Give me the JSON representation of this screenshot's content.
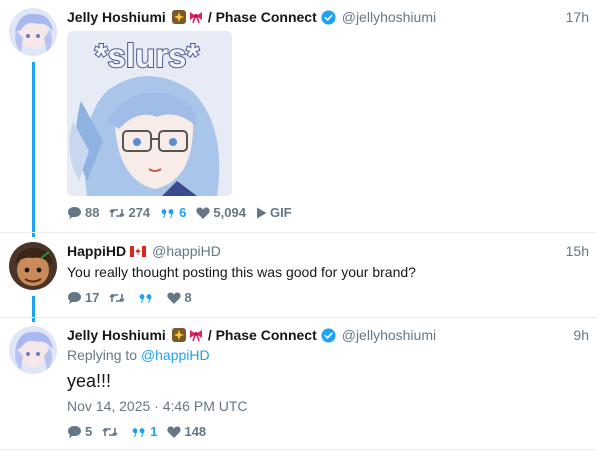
{
  "tweets": [
    {
      "display_name": "Jelly Hoshiumi",
      "affiliation": "/ Phase Connect",
      "handle": "@jellyhoshiumi",
      "time": "17h",
      "media": {
        "caption": "*slurs*",
        "type_label": "GIF"
      },
      "actions": {
        "replies": "88",
        "retweets": "274",
        "quotes": "6",
        "likes": "5,094"
      }
    },
    {
      "display_name": "HappiHD",
      "handle": "@happiHD",
      "time": "15h",
      "text": "You really thought posting this was good for your brand?",
      "actions": {
        "replies": "17",
        "retweets": "",
        "quotes": "",
        "likes": "8"
      }
    },
    {
      "display_name": "Jelly Hoshiumi",
      "affiliation": "/ Phase Connect",
      "handle": "@jellyhoshiumi",
      "time": "9h",
      "replying_prefix": "Replying to",
      "replying_to": "@happiHD",
      "text": "yea!!!",
      "timestamp": "Nov 14, 2025 · 4:46 PM UTC",
      "actions": {
        "replies": "5",
        "retweets": "",
        "quotes": "1",
        "likes": "148"
      }
    }
  ],
  "colors": {
    "accent": "#1da1f2",
    "muted": "#657786",
    "text": "#14171a",
    "divider": "#e6ecf0"
  }
}
